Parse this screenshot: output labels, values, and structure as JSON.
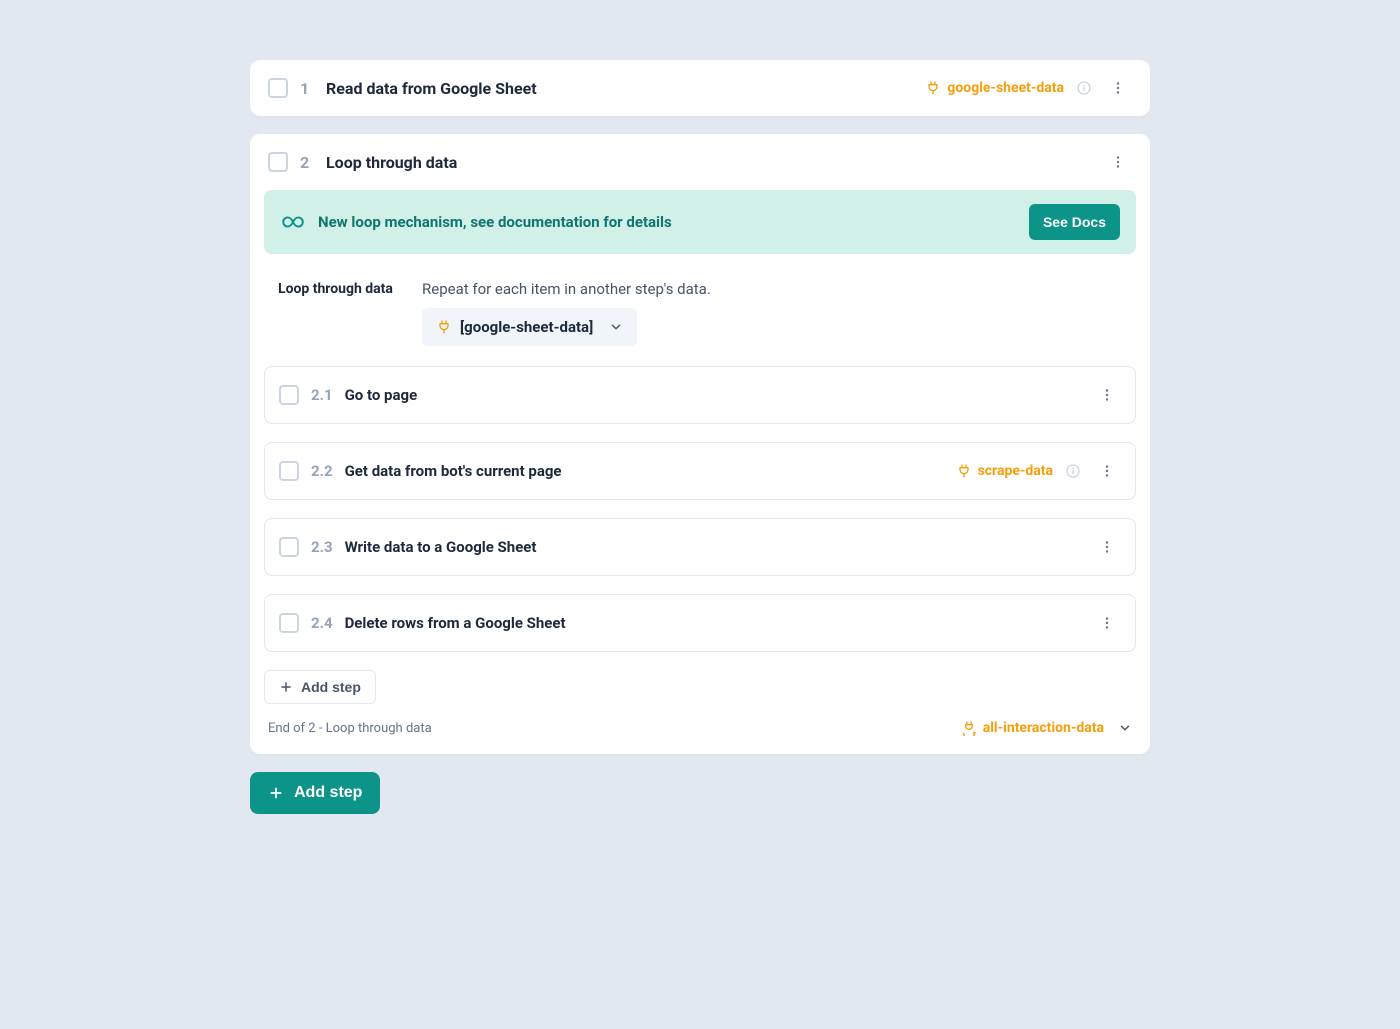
{
  "colors": {
    "accent": "#0d9488",
    "tag": "#f59e0b"
  },
  "step1": {
    "number": "1",
    "title": "Read data from Google Sheet",
    "tag": "google-sheet-data"
  },
  "step2": {
    "number": "2",
    "title": "Loop through data",
    "banner": {
      "message": "New loop mechanism, see documentation for details",
      "button": "See Docs"
    },
    "config": {
      "label": "Loop through data",
      "description": "Repeat for each item in another step's data.",
      "selected": "[google-sheet-data]"
    },
    "substeps": [
      {
        "number": "2.1",
        "title": "Go to page",
        "tag": null
      },
      {
        "number": "2.2",
        "title": "Get data from bot's current page",
        "tag": "scrape-data"
      },
      {
        "number": "2.3",
        "title": "Write data to a Google Sheet",
        "tag": null
      },
      {
        "number": "2.4",
        "title": "Delete rows from a Google Sheet",
        "tag": null
      }
    ],
    "add_step_label": "Add step",
    "end_text": "End of 2 - Loop through data",
    "footer_tag": "all-interaction-data"
  },
  "add_step_main": "Add step"
}
